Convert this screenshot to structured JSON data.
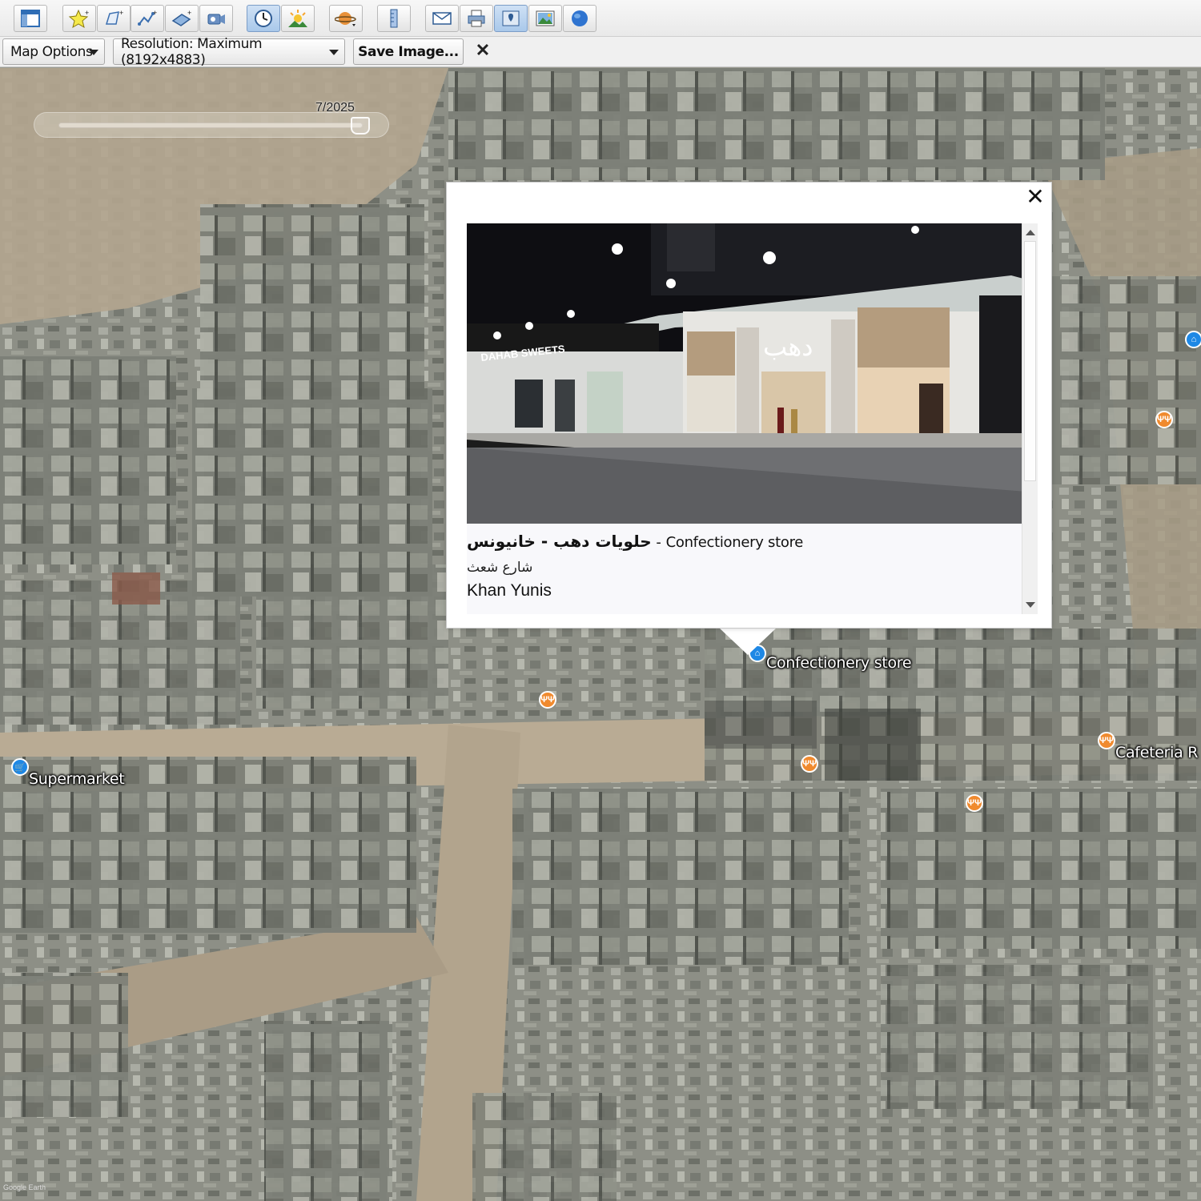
{
  "toolbar": {
    "buttons": [
      {
        "name": "sidebar-toggle-icon",
        "active": false
      },
      {
        "name": "add-placemark-icon",
        "active": false
      },
      {
        "name": "add-polygon-icon",
        "active": false
      },
      {
        "name": "add-path-icon",
        "active": false
      },
      {
        "name": "add-image-overlay-icon",
        "active": false
      },
      {
        "name": "record-tour-icon",
        "active": false
      },
      {
        "name": "historical-imagery-clock-icon",
        "active": true
      },
      {
        "name": "sunlight-icon",
        "active": false
      },
      {
        "name": "planets-icon",
        "active": false
      },
      {
        "name": "ruler-icon",
        "active": false
      },
      {
        "name": "email-icon",
        "active": false
      },
      {
        "name": "print-icon",
        "active": false
      },
      {
        "name": "view-in-maps-icon",
        "active": false
      },
      {
        "name": "save-image-icon",
        "active": false
      },
      {
        "name": "earth-globe-icon",
        "active": false
      }
    ]
  },
  "optionsbar": {
    "map_options_label": "Map Options",
    "resolution_label": "Resolution: Maximum (8192x4883)",
    "save_image_label": "Save Image...",
    "close_label": "✕"
  },
  "map": {
    "time_slider_label": "7/2025",
    "time_slider_position": 1.0,
    "labels": {
      "confectionery": "Confectionery store",
      "supermarket": "Supermarket",
      "cafeteria": "Cafeteria R"
    }
  },
  "balloon": {
    "close_label": "✕",
    "place_name": "حلويات دهب - خانيونس",
    "category": " - Confectionery store",
    "street": "شارع شعث",
    "city": "Khan Yunis",
    "photo": {
      "sign_left": "DAHAB SWEETS",
      "sign_center": "دهب"
    }
  },
  "attribution": "Google Earth",
  "colors": {
    "pin_orange": "#f08a2e",
    "pin_blue": "#1e88e5",
    "active_button": "#a9c8ea"
  }
}
